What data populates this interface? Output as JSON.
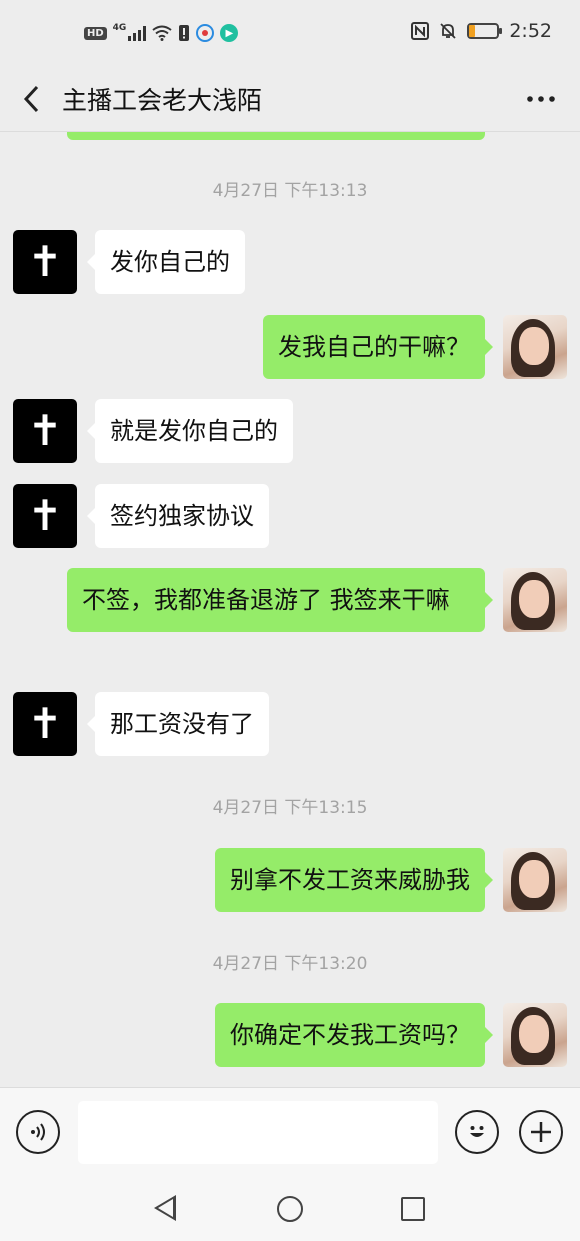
{
  "status_bar": {
    "hd": "HD",
    "network": "4G",
    "time": "2:52",
    "battery_level": 0.2,
    "icons": [
      "hd-icon",
      "signal-icon",
      "wifi-icon",
      "alert-icon",
      "app-icon",
      "play-icon",
      "nfc-icon",
      "mute-icon",
      "battery-icon"
    ]
  },
  "header": {
    "title": "主播工会老大浅陌",
    "back_icon": "chevron-left-icon",
    "more_icon": "more-icon"
  },
  "messages": [
    {
      "type": "timestamp",
      "text": "4月27日 下午13:13"
    },
    {
      "type": "message",
      "side": "left",
      "text": "发你自己的"
    },
    {
      "type": "message",
      "side": "right",
      "text": "发我自己的干嘛？"
    },
    {
      "type": "message",
      "side": "left",
      "text": "就是发你自己的"
    },
    {
      "type": "message",
      "side": "left",
      "text": "签约独家协议"
    },
    {
      "type": "message",
      "side": "right",
      "text": "不签，我都准备退游了 我签来干嘛"
    },
    {
      "type": "message",
      "side": "left",
      "text": "那工资没有了"
    },
    {
      "type": "timestamp",
      "text": "4月27日 下午13:15"
    },
    {
      "type": "message",
      "side": "right",
      "text": "别拿不发工资来威胁我"
    },
    {
      "type": "timestamp",
      "text": "4月27日 下午13:20"
    },
    {
      "type": "message",
      "side": "right",
      "text": "你确定不发我工资吗？"
    }
  ],
  "input_bar": {
    "voice_icon": "voice-icon",
    "placeholder": "",
    "emoji_icon": "emoji-icon",
    "plus_icon": "plus-icon"
  },
  "colors": {
    "self_bubble": "#95ec69",
    "other_bubble": "#ffffff",
    "background": "#ededed",
    "timestamp": "#a3a3a3"
  }
}
